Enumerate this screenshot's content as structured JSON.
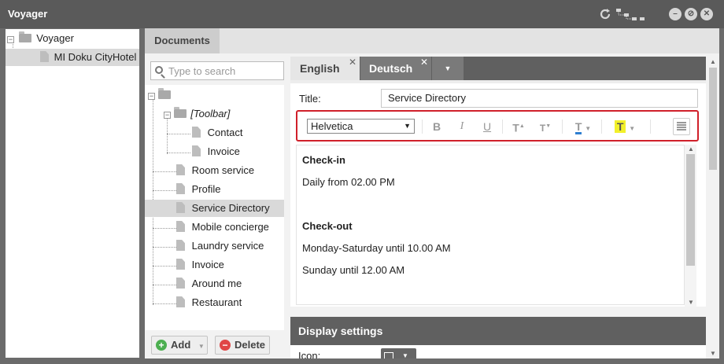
{
  "window": {
    "title": "Voyager"
  },
  "left_tree": {
    "root": "Voyager",
    "child": "MI Doku CityHotel"
  },
  "documents_tab": "Documents",
  "search": {
    "placeholder": "Type to search"
  },
  "doc_tree": {
    "toolbar_folder": "[Toolbar]",
    "toolbar_children": [
      "Contact",
      "Invoice"
    ],
    "items": [
      "Room service",
      "Profile",
      "Service Directory",
      "Mobile concierge",
      "Laundry service",
      "Invoice",
      "Around me",
      "Restaurant"
    ],
    "selected": "Service Directory"
  },
  "buttons": {
    "add": "Add",
    "delete": "Delete"
  },
  "languages": {
    "english": "English",
    "deutsch": "Deutsch"
  },
  "editor": {
    "title_label": "Title:",
    "title_value": "Service Directory",
    "font": "Helvetica",
    "content": {
      "checkin_heading": "Check-in",
      "checkin_text": "Daily from 02.00 PM",
      "checkout_heading": "Check-out",
      "checkout_weekday": "Monday-Saturday until 10.00 AM",
      "checkout_sunday": "Sunday until 12.00 AM"
    }
  },
  "display_settings": {
    "heading": "Display settings",
    "icon_label": "Icon:"
  },
  "colors": {
    "highlight_border": "#d0202a",
    "text_color_underline": "#2f7fd0",
    "highlight_yellow": "#f2f02a"
  }
}
